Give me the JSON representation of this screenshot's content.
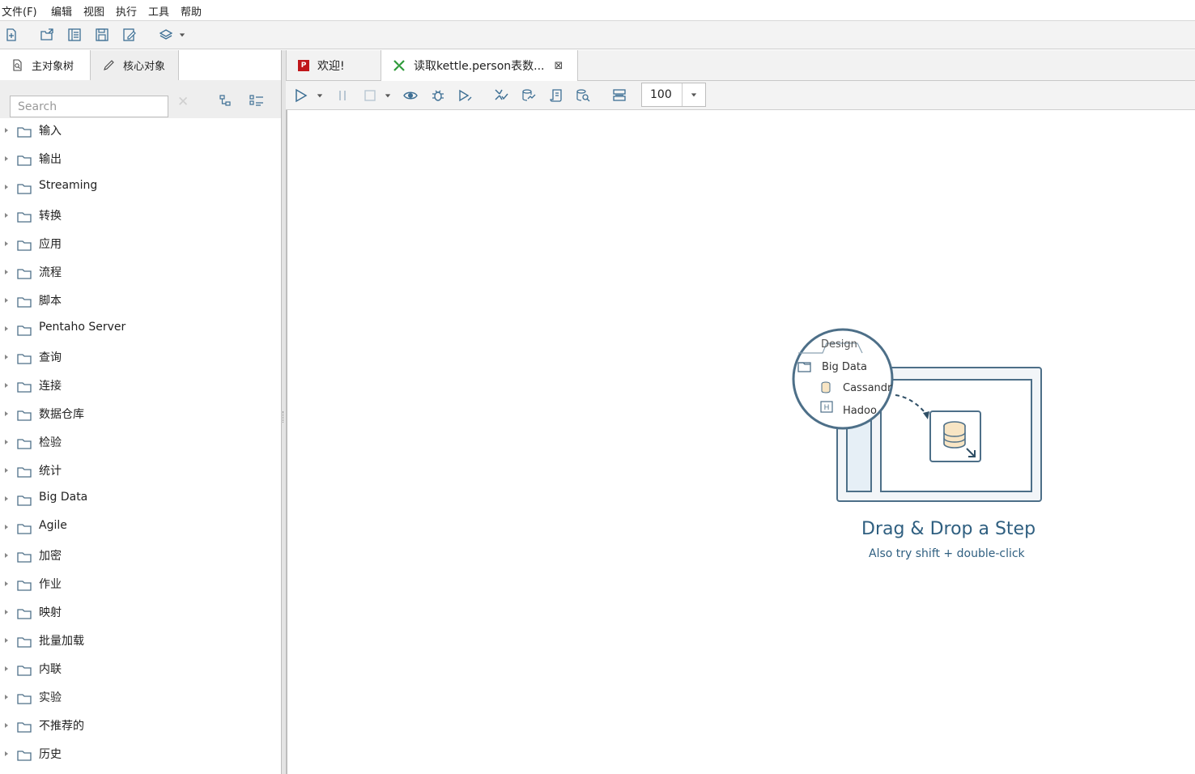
{
  "menu": [
    "文件(F)",
    "编辑",
    "视图",
    "执行",
    "工具",
    "帮助"
  ],
  "toolbar": {
    "icons": [
      "new-file-icon",
      "open-file-icon",
      "explore-repository-icon",
      "save-icon",
      "save-as-icon",
      "layers-icon"
    ]
  },
  "left_panel": {
    "tabs": [
      {
        "label": "主对象树",
        "icon": "object-tree-icon"
      },
      {
        "label": "核心对象",
        "icon": "pencil-icon"
      }
    ],
    "search": {
      "placeholder": "Search",
      "value": ""
    },
    "tree_items": [
      "输入",
      "输出",
      "Streaming",
      "转换",
      "应用",
      "流程",
      "脚本",
      "Pentaho Server",
      "查询",
      "连接",
      "数据仓库",
      "检验",
      "统计",
      "Big Data",
      "Agile",
      "加密",
      "作业",
      "映射",
      "批量加载",
      "内联",
      "实验",
      "不推荐的",
      "历史"
    ]
  },
  "editor": {
    "tabs": [
      {
        "label": "欢迎!",
        "icon": "pentaho-welcome-icon"
      },
      {
        "label": "读取kettle.person表数...",
        "icon": "transformation-icon",
        "closable": true
      }
    ],
    "zoom": "100"
  },
  "canvas_hint": {
    "design_tab": "Design",
    "folder_label": "Big Data",
    "item1": "Cassandr",
    "item2": "Hadoo",
    "title": "Drag & Drop a Step",
    "subtitle": "Also try shift + double-click"
  },
  "colors": {
    "accent": "#2f5f80",
    "hint_text": "#2f5f80",
    "canvas_bg": "#ffffff"
  }
}
